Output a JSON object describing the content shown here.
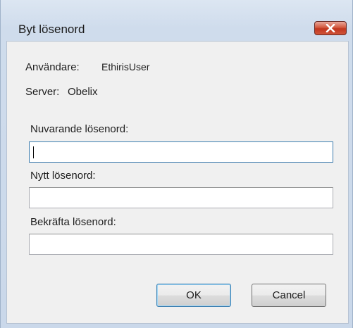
{
  "window": {
    "title": "Byt lösenord",
    "close_icon": "close-x-icon"
  },
  "info": {
    "user_label": "Användare:",
    "user_value": "EthirisUser",
    "server_label": "Server:",
    "server_value": "Obelix"
  },
  "fields": {
    "current_label": "Nuvarande lösenord:",
    "current_value": "",
    "new_label": "Nytt lösenord:",
    "new_value": "",
    "confirm_label": "Bekräfta lösenord:",
    "confirm_value": ""
  },
  "buttons": {
    "ok_label": "OK",
    "cancel_label": "Cancel"
  },
  "colors": {
    "close_button": "#c94a31",
    "focus_border": "#3d7bad"
  }
}
